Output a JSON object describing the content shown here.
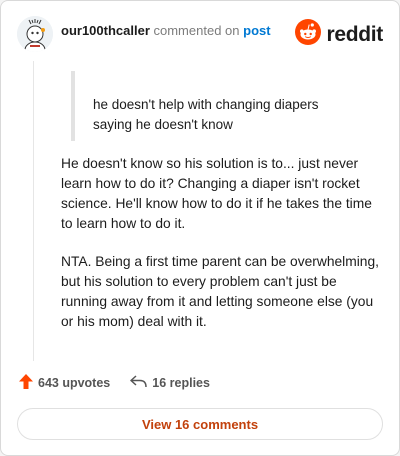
{
  "header": {
    "username": "our100thcaller",
    "action_text": "commented on",
    "post_link": "post",
    "logo_text": "reddit",
    "brand_color": "#ff4500"
  },
  "quote": {
    "text": "he doesn't help with changing diapers saying he doesn't know"
  },
  "comment": {
    "paragraphs": [
      "He doesn't know so his solution is to... just never learn how to do it? Changing a diaper isn't rocket science. He'll know how to do it if he takes the time to learn how to do it.",
      "NTA. Being a first time parent can be overwhelming, but his solution to every problem can't just be running away from it and letting someone else (you or his mom) deal with it."
    ]
  },
  "stats": {
    "upvotes": "643 upvotes",
    "replies": "16 replies"
  },
  "footer": {
    "view_comments": "View 16 comments"
  },
  "icons": {
    "upvote": "upvote-arrow-icon",
    "reply": "reply-arrow-icon",
    "logo": "reddit-snoo-icon",
    "avatar": "user-avatar"
  }
}
